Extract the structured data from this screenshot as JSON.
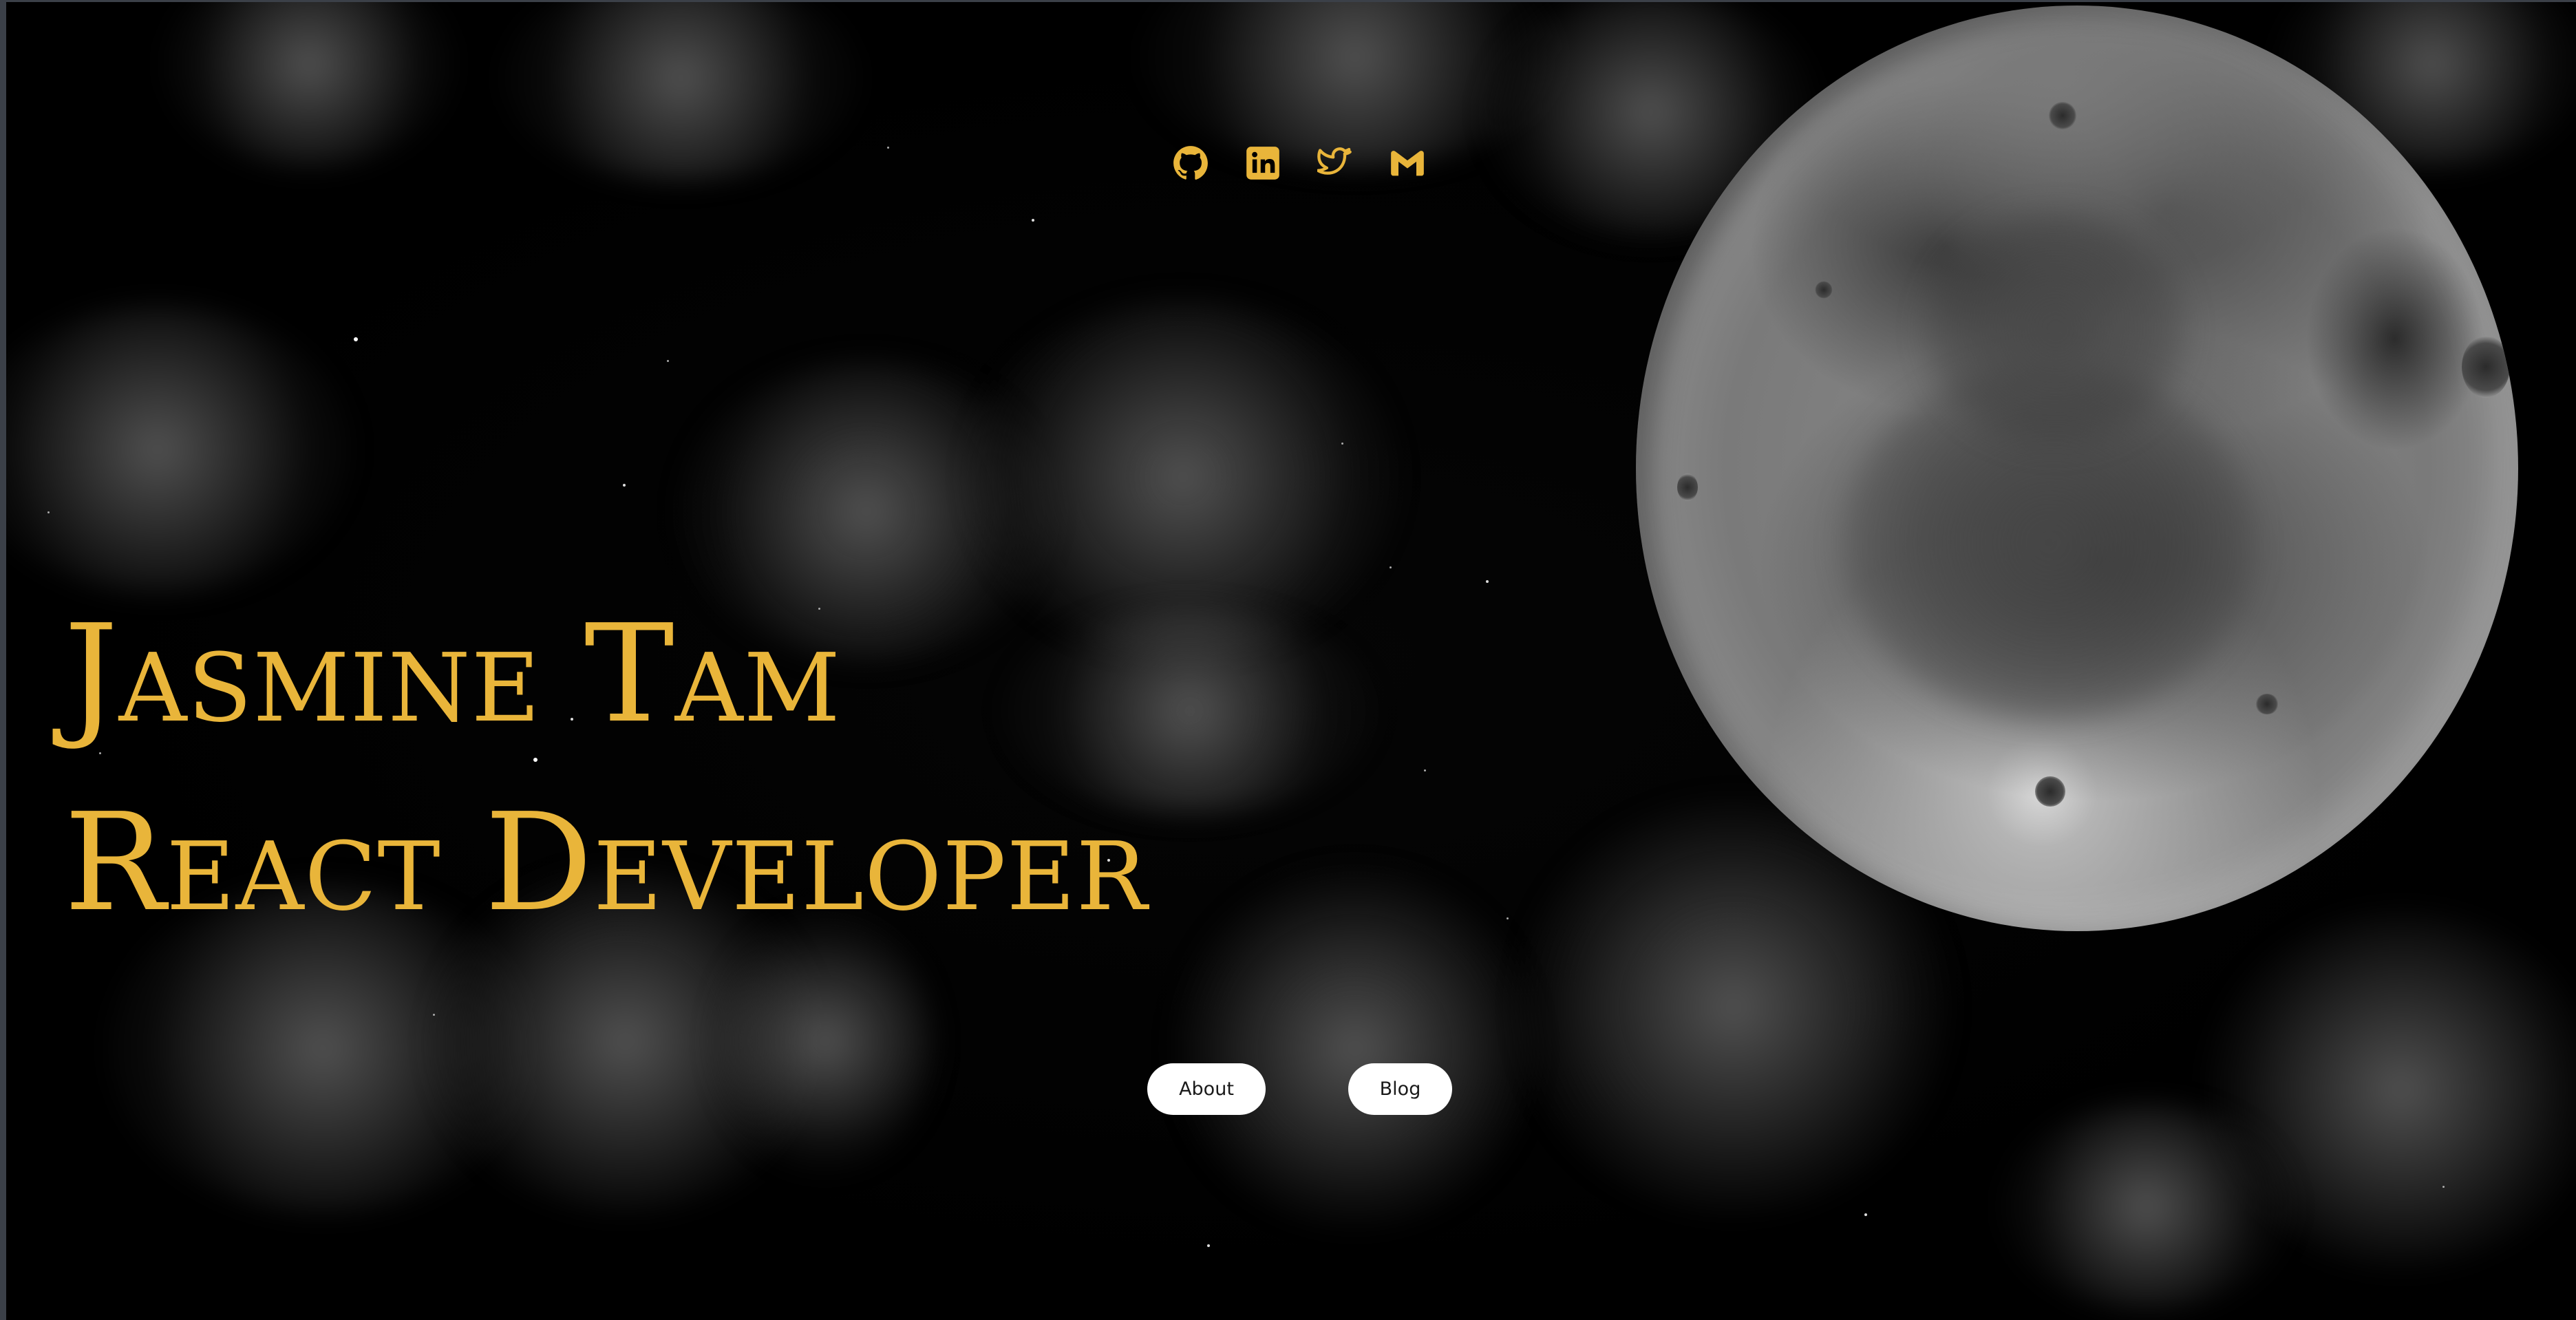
{
  "hero": {
    "name": "Jasmine Tam",
    "role": "React Developer"
  },
  "social": [
    {
      "icon": "github-icon",
      "label": "GitHub"
    },
    {
      "icon": "linkedin-icon",
      "label": "LinkedIn"
    },
    {
      "icon": "twitter-icon",
      "label": "Twitter"
    },
    {
      "icon": "gmail-icon",
      "label": "Gmail"
    }
  ],
  "nav": {
    "about_label": "About",
    "blog_label": "Blog"
  },
  "colors": {
    "accent": "#e9b53a",
    "background": "#000000",
    "button_bg": "#ffffff",
    "button_text": "#1a1a1a"
  }
}
